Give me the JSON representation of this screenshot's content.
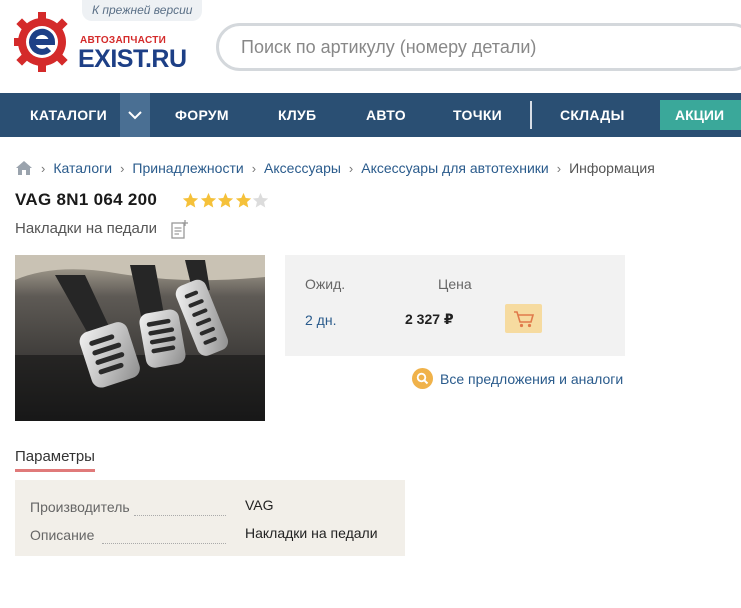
{
  "header": {
    "old_version_link": "К прежней версии",
    "logo_sub": "АВТОЗАПЧАСТИ",
    "logo_main": "EXIST.RU",
    "search_placeholder": "Поиск по артикулу (номеру детали)"
  },
  "nav": {
    "catalogs": "КАТАЛОГИ",
    "forum": "ФОРУМ",
    "club": "КЛУБ",
    "auto": "АВТО",
    "points": "ТОЧКИ",
    "stores": "СКЛАДЫ",
    "sales": "АКЦИИ"
  },
  "breadcrumb": {
    "items": [
      "Каталоги",
      "Принадлежности",
      "Аксессуары",
      "Аксессуары для автотехники"
    ],
    "current": "Информация"
  },
  "product": {
    "title": "VAG 8N1 064 200",
    "rating": 4,
    "rating_max": 5,
    "subtitle": "Накладки на педали"
  },
  "offer": {
    "header_wait": "Ожид.",
    "header_price": "Цена",
    "days": "2 дн.",
    "price": "2 327 ₽"
  },
  "all_offers_link": "Все предложения и аналоги",
  "params": {
    "title": "Параметры",
    "rows": [
      {
        "label": "Производитель",
        "value": "VAG"
      },
      {
        "label": "Описание",
        "value": "Накладки на педали"
      }
    ]
  },
  "colors": {
    "nav_bg": "#2a4f73",
    "sales_bg": "#3aa89a",
    "link": "#2a5b8c",
    "star": "#f5c13a",
    "cart_bg": "#f6dba0"
  }
}
